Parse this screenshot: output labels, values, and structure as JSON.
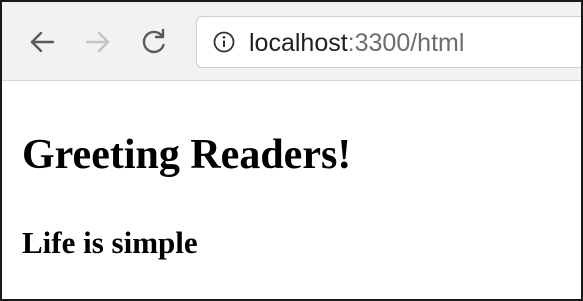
{
  "browser": {
    "nav": {
      "back_icon": "arrow-left-icon",
      "forward_icon": "arrow-right-icon",
      "reload_icon": "reload-icon",
      "forward_enabled": false
    },
    "address_bar": {
      "info_icon": "info-circle-icon",
      "url_host": "localhost",
      "url_rest": ":3300/html"
    }
  },
  "page": {
    "heading": "Greeting Readers!",
    "subheading": "Life is simple"
  },
  "colors": {
    "toolbar_bg": "#f2f2f2",
    "icon_active": "#5a5a5a",
    "icon_disabled": "#c4c4c4",
    "url_muted": "#6d6d6d"
  }
}
